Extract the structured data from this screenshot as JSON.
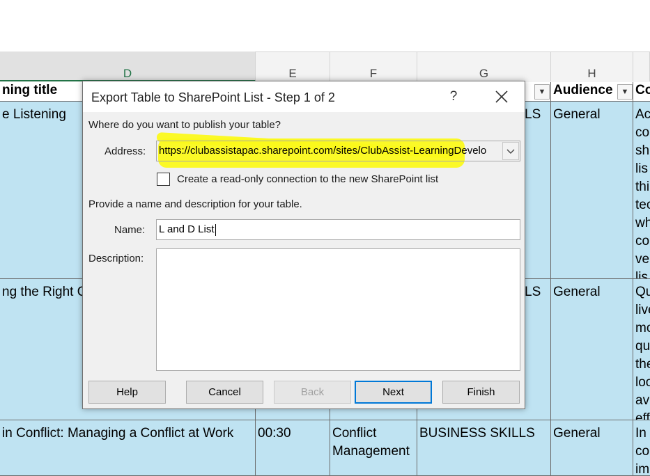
{
  "sheet": {
    "columns": [
      "D",
      "E",
      "F",
      "G",
      "H"
    ],
    "headers": {
      "d": "ning title",
      "audience": "Audience",
      "i_partial": "Co"
    },
    "rows": [
      {
        "d": "e Listening",
        "g": "LS",
        "h": "General",
        "i_lines": [
          "Ac",
          "co",
          "sh",
          "lis",
          "thi",
          "tec",
          "wh",
          "co",
          "ve",
          "lis"
        ]
      },
      {
        "d": "ng the Right Q",
        "g": "LS",
        "h": "General",
        "i_lines": [
          "Qu",
          "live",
          "mo",
          "qu",
          "the",
          "loo",
          "av",
          "eff"
        ]
      },
      {
        "d": " in Conflict: Managing a Conflict at Work",
        "e": "00:30",
        "f": "Conflict Management",
        "g": "BUSINESS SKILLS",
        "h": "General",
        "i_lines": [
          "In",
          "co",
          "im"
        ]
      }
    ]
  },
  "dialog": {
    "title": "Export Table to SharePoint List - Step 1 of 2",
    "help_glyph": "?",
    "prompt_publish": "Where do you want to publish your table?",
    "address_label": "Address:",
    "address_value": "https://clubassistapac.sharepoint.com/sites/ClubAssist-LearningDevelo",
    "readonly_checkbox_label": "Create a read-only connection to the new SharePoint list",
    "readonly_checked": false,
    "prompt_name": "Provide a name and description for your table.",
    "name_label": "Name:",
    "name_value": "L and D List",
    "description_label": "Description:",
    "description_value": "",
    "buttons": {
      "help": "Help",
      "cancel": "Cancel",
      "back": "Back",
      "next": "Next",
      "finish": "Finish"
    }
  },
  "colors": {
    "cell_fill": "#bfe3f2",
    "highlight": "#fbf91b",
    "focus_border": "#0078d7"
  }
}
